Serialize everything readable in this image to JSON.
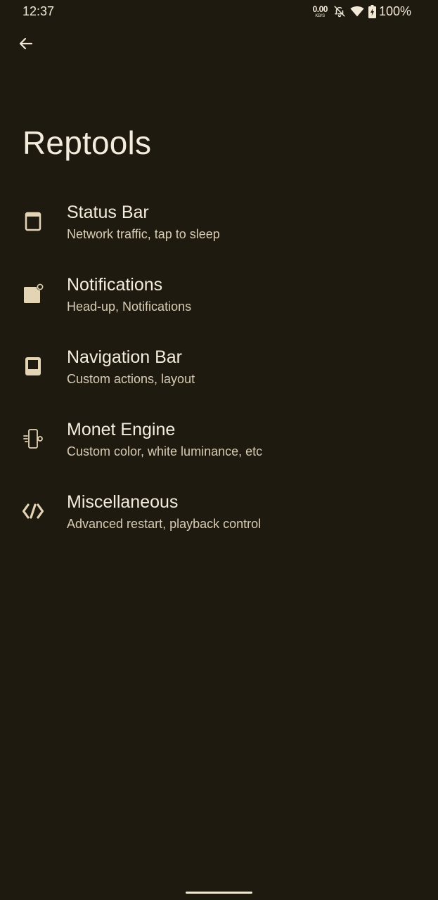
{
  "status_bar": {
    "time": "12:37",
    "net_speed_value": "0.00",
    "net_speed_unit": "KB/S",
    "battery_percent": "100%",
    "icons": [
      "net-speed",
      "bell-off-icon",
      "wifi-icon",
      "battery-icon"
    ]
  },
  "page": {
    "title": "Reptools"
  },
  "items": [
    {
      "title": "Status Bar",
      "subtitle": "Network traffic, tap to sleep",
      "icon": "status-bar-icon"
    },
    {
      "title": "Notifications",
      "subtitle": "Head-up, Notifications",
      "icon": "notifications-icon"
    },
    {
      "title": "Navigation Bar",
      "subtitle": "Custom actions, layout",
      "icon": "navigation-bar-icon"
    },
    {
      "title": "Monet Engine",
      "subtitle": "Custom color, white luminance, etc",
      "icon": "monet-engine-icon"
    },
    {
      "title": "Miscellaneous",
      "subtitle": "Advanced restart, playback control",
      "icon": "code-icon"
    }
  ],
  "colors": {
    "background": "#1e1a10",
    "text_primary": "#f3ecdd",
    "text_secondary": "#d8ccb4",
    "icon_accent": "#e2d4b4"
  }
}
